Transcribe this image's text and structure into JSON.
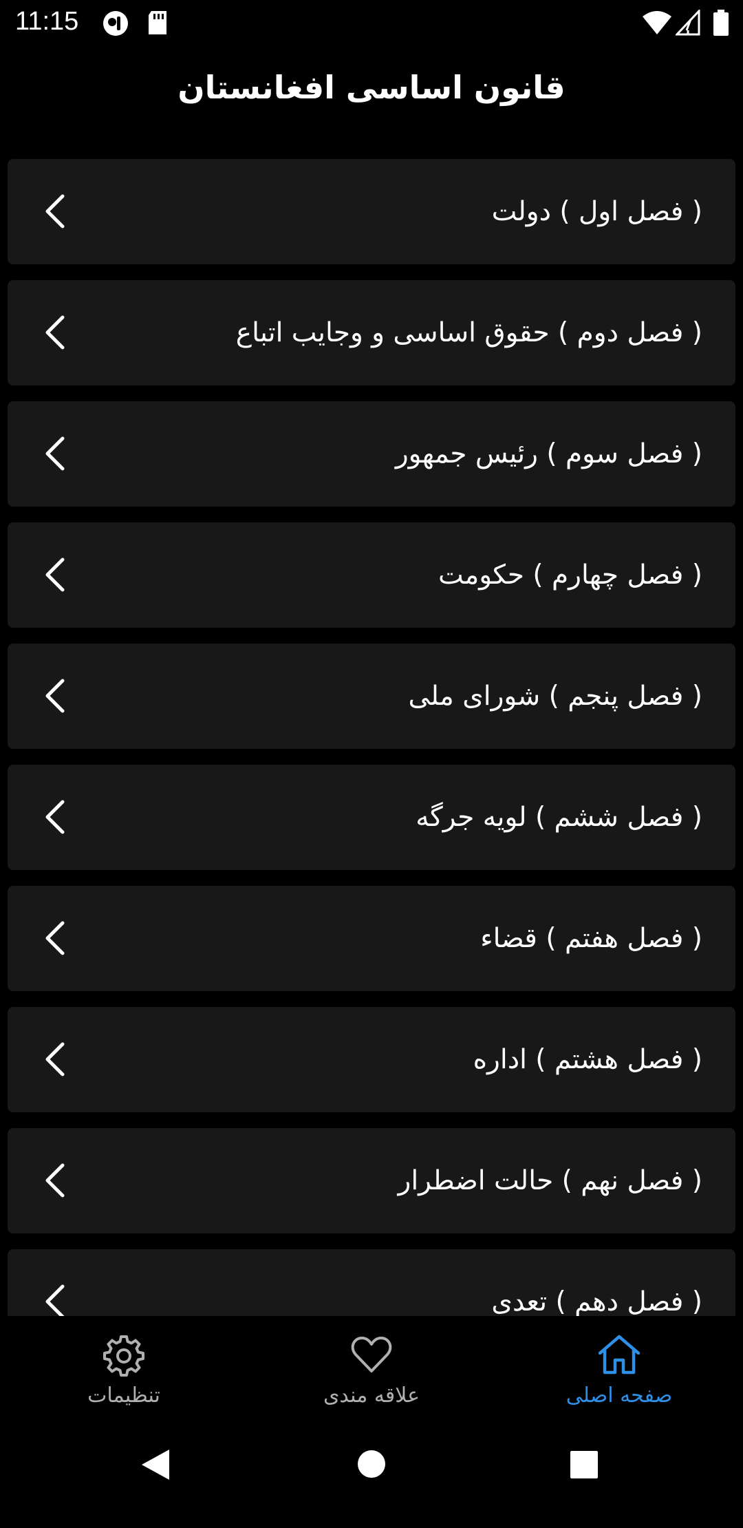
{
  "status_bar": {
    "time": "11:15"
  },
  "header": {
    "title": "قانون اساسی افغانستان"
  },
  "chapters": [
    {
      "label": "( فصل اول ) دولت"
    },
    {
      "label": "( فصل دوم ) حقوق اساسی و وجایب اتباع"
    },
    {
      "label": "( فصل سوم ) رئیس جمهور"
    },
    {
      "label": "( فصل چهارم ) حکومت"
    },
    {
      "label": "( فصل پنجم ) شورای ملی"
    },
    {
      "label": "( فصل ششم ) لویه جرگه"
    },
    {
      "label": "( فصل هفتم ) قضاء"
    },
    {
      "label": "( فصل هشتم ) اداره"
    },
    {
      "label": "( فصل نهم ) حالت اضطرار"
    },
    {
      "label": "( فصل دهم ) تعدی"
    }
  ],
  "bottom_nav": {
    "settings": {
      "label": "تنظیمات",
      "icon": "gear-icon"
    },
    "favorites": {
      "label": "علاقه مندی",
      "icon": "heart-icon"
    },
    "home": {
      "label": "صفحه اصلی",
      "icon": "home-icon",
      "active": true
    }
  },
  "colors": {
    "accent": "#2f8fe6",
    "inactive": "#b0b0b0",
    "card": "#181818",
    "background": "#000000"
  }
}
